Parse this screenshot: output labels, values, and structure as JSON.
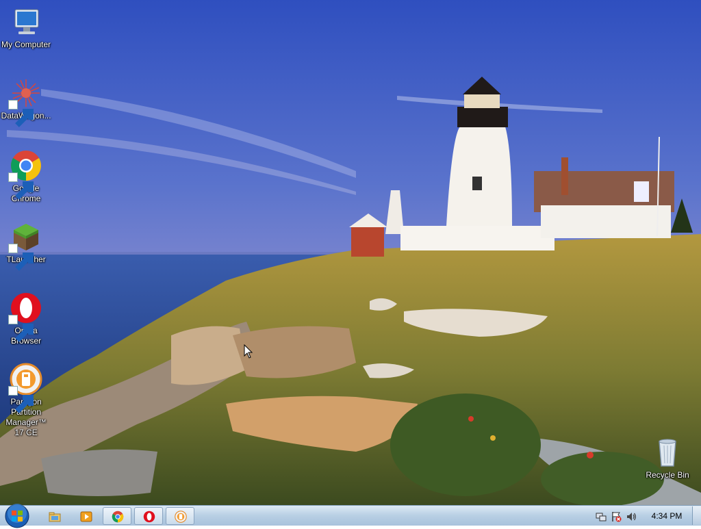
{
  "desktop": {
    "icons": [
      {
        "label": "My Computer",
        "icon": "computer-icon"
      },
      {
        "label": "DataWagon...",
        "icon": "datawagon-icon"
      },
      {
        "label": "Google Chrome",
        "icon": "chrome-icon"
      },
      {
        "label": "TLauncher",
        "icon": "tlauncher-icon"
      },
      {
        "label": "Opera Browser",
        "icon": "opera-icon"
      },
      {
        "label": "Paragon Partition Manager™ 17 CE",
        "icon": "paragon-icon"
      },
      {
        "label": "Recycle Bin",
        "icon": "recycle-bin-icon"
      }
    ]
  },
  "taskbar": {
    "start": "start-orb-icon",
    "pinned": [
      "file-explorer-icon",
      "media-player-icon",
      "chrome-icon",
      "opera-icon",
      "paragon-icon"
    ],
    "tray": [
      "network-icon",
      "action-center-icon",
      "volume-icon"
    ],
    "clock": "4:34 PM"
  },
  "colors": {
    "sky_top": "#3a5cc0",
    "sea": "#2d4f9a",
    "taskbar": "#b8cfe4"
  }
}
